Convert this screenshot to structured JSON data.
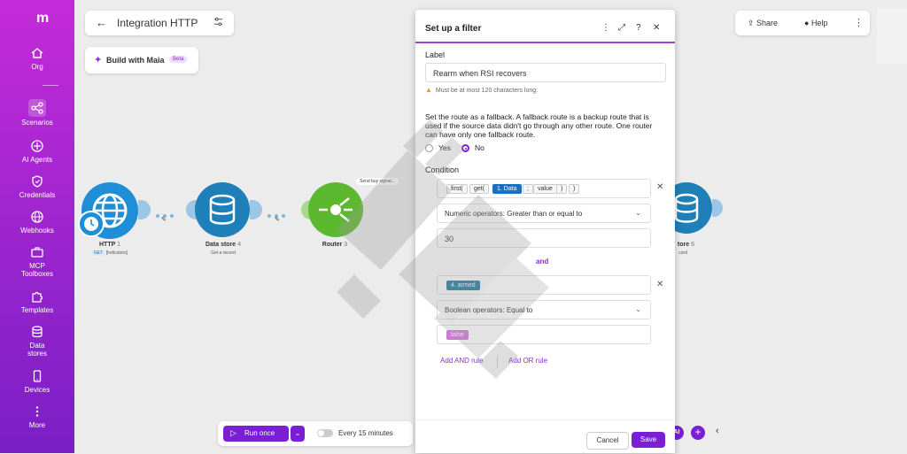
{
  "sidebar": {
    "logo": "m",
    "items": [
      {
        "label": "Org",
        "icon": "home-icon"
      },
      {
        "label": "Scenarios",
        "icon": "share-nodes-icon",
        "active": true
      },
      {
        "label": "AI Agents",
        "icon": "agent-icon"
      },
      {
        "label": "Credentials",
        "icon": "shield-icon"
      },
      {
        "label": "Webhooks",
        "icon": "globe-icon"
      },
      {
        "label": "MCP Toolboxes",
        "icon": "toolbox-icon"
      },
      {
        "label": "Templates",
        "icon": "puzzle-icon"
      },
      {
        "label": "Data stores",
        "icon": "database-icon"
      },
      {
        "label": "Devices",
        "icon": "phone-icon"
      },
      {
        "label": "More",
        "icon": "more-icon"
      }
    ]
  },
  "header": {
    "title": "Integration HTTP",
    "maia_label": "Build with Maia",
    "maia_badge": "Beta",
    "share_label": "Share",
    "help_label": "Help"
  },
  "modules": {
    "http": {
      "label": "HTTP",
      "badge": "1",
      "method": "GET",
      "sub": "[Indicators]"
    },
    "datastore": {
      "label": "Data store",
      "badge": "4",
      "sub": "Get a record"
    },
    "router": {
      "label": "Router",
      "badge": "3"
    },
    "route_label": "Send buy signal...",
    "right_label": "tore",
    "right_badge": "6",
    "right_sub": "cord"
  },
  "bottom_bar": {
    "run_label": "Run once",
    "schedule_label": "Every 15 minutes",
    "ai_label": "AI"
  },
  "filter_panel": {
    "title": "Set up a filter",
    "label_heading": "Label",
    "label_value": "Rearm when RSI recovers",
    "label_warning": "Must be at most 120 characters long.",
    "fallback_text": "Set the route as a fallback. A fallback route is a backup route that is used if the source data didn't go through any other route. One router can have only one fallback route.",
    "fallback_yes": "Yes",
    "fallback_no": "No",
    "fallback_selected": "No",
    "condition_heading": "Condition",
    "condition1": {
      "fn_first": "first(",
      "fn_get": "get(",
      "var": "1. Data",
      "sep": ";",
      "arg": "value",
      "close1": ")",
      "close2": ")",
      "operator": "Numeric operators: Greater than or equal to",
      "value": "30"
    },
    "and_label": "and",
    "condition2": {
      "var": "4. armed",
      "operator": "Boolean operators: Equal to",
      "value": "false"
    },
    "add_and": "Add AND rule",
    "add_or": "Add OR rule",
    "cancel": "Cancel",
    "save": "Save"
  },
  "colors": {
    "accent": "#7a1fd6",
    "http_module": "#1e8fd6",
    "router_module": "#5cb82f"
  }
}
